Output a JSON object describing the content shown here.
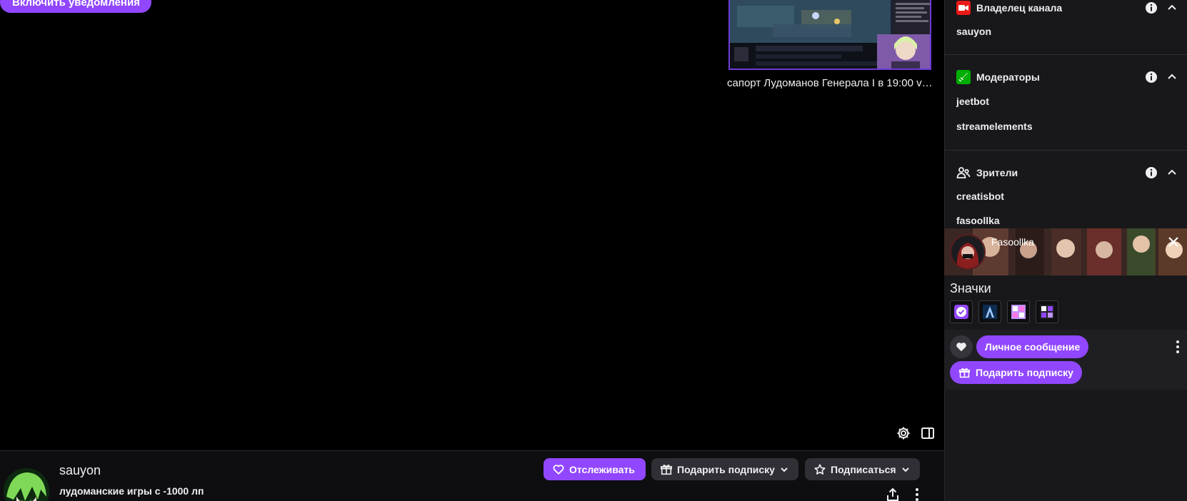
{
  "video": {
    "notify_button": "Включить уведомления",
    "suggested_title": "сапорт Лудоманов Генерала I в 19:00 vs…",
    "controls": {
      "settings_icon": "gear-icon",
      "theatre_icon": "sidebar-icon"
    }
  },
  "channel": {
    "name": "sauyon",
    "title": "лудоманские игры с -1000 лп",
    "follow_label": "Отслеживать",
    "gift_label": "Подарить подписку",
    "subscribe_label": "Подписаться"
  },
  "panel": {
    "owner": {
      "title": "Владелец канала",
      "users": [
        "sauyon"
      ]
    },
    "moderators": {
      "title": "Модераторы",
      "users": [
        "jeetbot",
        "streamelements"
      ]
    },
    "viewers": {
      "title": "Зрители",
      "users": [
        "creatisbot",
        "fasoollka"
      ]
    }
  },
  "card": {
    "username": "Fasoollka",
    "badges_title": "Значки",
    "badges": [
      "verified-badge",
      "arcane-badge",
      "2023-badge",
      "2024-badge"
    ],
    "dm_label": "Личное сообщение",
    "gift_label": "Подарить подписку"
  },
  "colors": {
    "accent": "#9147ff",
    "owner_badge": "#e91916",
    "mod_badge": "#00ad03",
    "panel_bg": "#18181b"
  }
}
